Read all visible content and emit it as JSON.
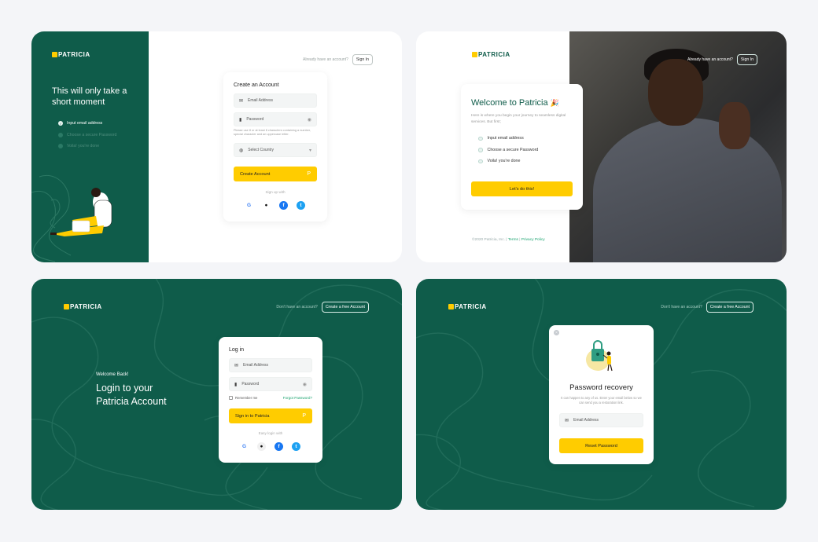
{
  "brand": {
    "name": "PATRICIA",
    "yellow": "#ffcc00",
    "green": "#0f5c4a",
    "link_green": "#1aa36f"
  },
  "signup": {
    "have_account": "Already have an account?",
    "sign_in": "Sign In",
    "side_title": "This will only take a short moment",
    "steps": [
      "Input email address",
      "Choose a secure Password",
      "Voila! you're done"
    ],
    "card_title": "Create an Account",
    "email_placeholder": "Email Address",
    "password_placeholder": "Password",
    "password_hint": "Please use 8 or at least 8 characters containing a number, special character and an uppercase letter.",
    "country_placeholder": "Select Country",
    "create_button": "Create Account",
    "sign_up_with": "Sign up with"
  },
  "welcome": {
    "have_account": "Already have an account?",
    "sign_in": "Sign In",
    "title": "Welcome to Patricia",
    "emoji": "🎉",
    "subtitle": "Here is where you begin your journey to seamless digital services. But first;",
    "steps": [
      "Input email address",
      "Choose a secure Password",
      "Voila! you're done"
    ],
    "cta": "Let's do this!",
    "footer_copy": "©2020 Patricia, Inc.",
    "footer_sep": "|",
    "terms": "Terms",
    "privacy": "Privacy Policy"
  },
  "login": {
    "no_account": "Don't have an account?",
    "create_free": "Create a free Account",
    "welcome_back": "Welcome Back!",
    "headline_1": "Login to your",
    "headline_2": "Patricia Account",
    "card_title": "Log in",
    "email_placeholder": "Email Address",
    "password_placeholder": "Password",
    "remember": "Remember me",
    "forgot": "Forgot Password?",
    "sign_in_button": "Sign in to Patricia",
    "easy_login": "Easy login with"
  },
  "recovery": {
    "no_account": "Don't have an account?",
    "create_free": "Create a free Account",
    "title": "Password recovery",
    "subtitle": "It can happen to any of us. Enter your email below so we can send you a restoration link.",
    "email_placeholder": "Email Address",
    "reset_button": "Reset Password",
    "close": "×"
  },
  "icons": {
    "google": "G",
    "apple": "",
    "facebook": "f",
    "twitter": "t",
    "mail": "✉",
    "lock": "🔒",
    "eye": "◉",
    "globe": "◍",
    "chevron": "▾",
    "check": "✓",
    "brand_mark": "P"
  }
}
